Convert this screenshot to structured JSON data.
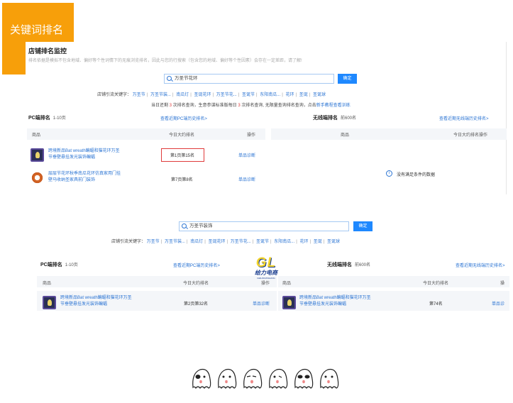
{
  "badge": {
    "label": "关键词排名"
  },
  "panel": {
    "title": "店铺排名监控",
    "subtitle": "排名依据是模拟不包含地域、偏好等个性词情下的无痕浏览排名，因此与您的行搜索（包含您的地域、偏好等个性因素）会存在一定差距，请了解!",
    "search_button": "确定"
  },
  "top": {
    "search_value": "万圣节花环",
    "kw_prefix": "店铺引流关键字：",
    "keywords": [
      "万圣节",
      "万圣节装...",
      "南瓜灯",
      "圣诞花环",
      "万圣节花...",
      "圣诞节",
      "东阳南瓜...",
      "花环",
      "圣诞",
      "圣诞球"
    ],
    "notice": {
      "p1": "当日还剩 ",
      "n1": "3",
      "p2": " 次排名查询，生意参谋标准版每日 ",
      "n2": "3",
      "p3": " 次排名查询, 无限量查询排名查询，点击",
      "link": "新手教程查看训练"
    },
    "pc": {
      "title": "PC端排名",
      "range": "1-10页",
      "history_link": "查看近期PC端历史排名>",
      "columns": [
        "商品",
        "今日大约排名",
        "操作"
      ],
      "rows": [
        {
          "name": "跨境新品Bat wreath蝙蝠和猫花环万圣节垂壁悬挂发光装饰蝙蝠",
          "rank": "第1页第15名",
          "action": "单品诊断"
        },
        {
          "name": "层层节花环秋季南瓜花环仿真家用门挂壁马收纳圣家具前门装饰",
          "rank": "第7页第8名",
          "action": "单品诊断"
        }
      ]
    },
    "wireless": {
      "title": "无线端排名",
      "range": "前600名",
      "history_link": "查看近期无线端历史排名>",
      "columns": [
        "商品",
        "今日大约排名操作"
      ],
      "empty": "没有满足条件的数据"
    }
  },
  "bottom": {
    "search_value": "万圣节装饰",
    "kw_prefix": "店铺引流关键字：",
    "keywords": [
      "万圣节",
      "万圣节装...",
      "南瓜灯",
      "圣诞花环",
      "万圣节花...",
      "圣诞节",
      "东阳南瓜...",
      "花环",
      "圣诞",
      "圣诞球"
    ],
    "pc": {
      "title": "PC端排名",
      "range": "1-10页",
      "history_link": "查看近期PC端历史排名>",
      "columns": [
        "商品",
        "今日大约排名",
        "操作"
      ],
      "rows": [
        {
          "name": "跨境新品Bat wreath蝙蝠和猫花环万圣节垂壁悬挂发光装饰蝙蝠",
          "rank": "第2页第32名",
          "action": "单品诊断"
        }
      ]
    },
    "wireless": {
      "title": "无线端排名",
      "range": "前600名",
      "history_link": "查看近期无线端历史排名>",
      "columns": [
        "商品",
        "今日大约排名",
        "操"
      ],
      "rows": [
        {
          "name": "跨境新品Bat wreath蝙蝠和猫花环万圣节垂壁悬挂发光装饰蝙蝠",
          "rank": "第74名",
          "action": "单品诊"
        }
      ]
    }
  },
  "logo": {
    "gl": "GL",
    "cn": "给力电商",
    "tag": "GEILIDIANSHANG"
  },
  "colors": {
    "badge": "#f79f0a",
    "link": "#2b74d3",
    "button": "#1e88ff",
    "highlight": "#e03b3b"
  }
}
